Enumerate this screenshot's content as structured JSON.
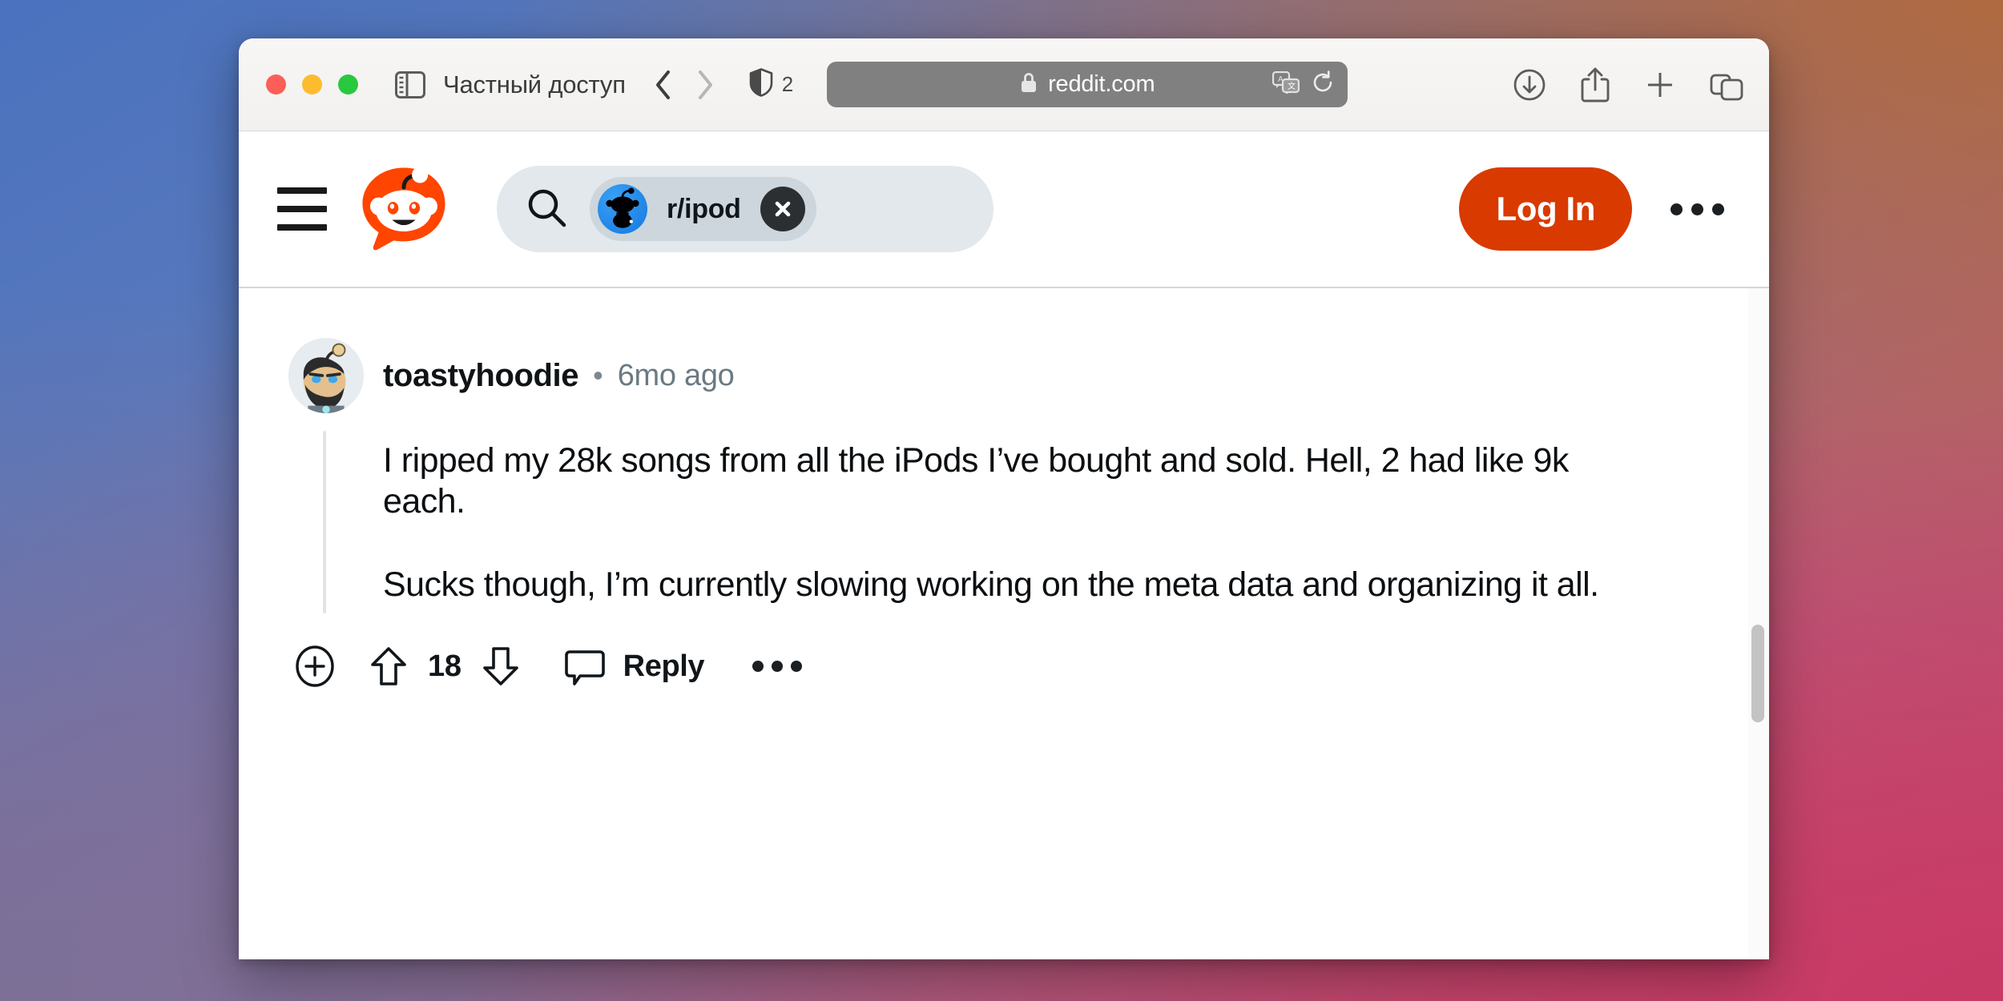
{
  "browser": {
    "traffic_lights": [
      "close",
      "minimize",
      "zoom"
    ],
    "sidebar_icon": "sidebar-icon",
    "private_label": "Частный доступ",
    "back_icon": "chevron-left-icon",
    "forward_icon": "chevron-right-icon",
    "shield_icon": "privacy-shield-icon",
    "tracker_count": "2",
    "url": {
      "lock_icon": "lock-icon",
      "text": "reddit.com",
      "translate_icon": "translate-icon",
      "reload_icon": "reload-icon"
    },
    "tools": [
      {
        "name": "downloads-icon"
      },
      {
        "name": "share-icon"
      },
      {
        "name": "new-tab-icon"
      },
      {
        "name": "tab-overview-icon"
      }
    ]
  },
  "reddit": {
    "menu_icon": "hamburger-menu-icon",
    "logo_icon": "reddit-snoo-logo",
    "search": {
      "search_icon": "search-icon",
      "chip_avatar": "subreddit-avatar",
      "chip_label": "r/ipod",
      "clear_icon": "close-x-icon"
    },
    "login_label": "Log In",
    "overflow_icon": "more-options-icon",
    "accent_color": "#d93a00"
  },
  "comment": {
    "avatar": "user-avatar",
    "username": "toastyhoodie",
    "separator": "•",
    "timestamp": "6mo ago",
    "paragraphs": [
      "I ripped my 28k songs from all the iPods I’ve bought and sold. Hell, 2 had like 9k each.",
      "Sucks though, I’m currently slowing working on the meta data and organizing it all."
    ],
    "actions": {
      "expand_icon": "expand-plus-icon",
      "upvote_icon": "upvote-arrow-icon",
      "vote_count": "18",
      "downvote_icon": "downvote-arrow-icon",
      "reply_icon": "comment-bubble-icon",
      "reply_label": "Reply",
      "overflow_icon": "more-options-icon"
    }
  }
}
